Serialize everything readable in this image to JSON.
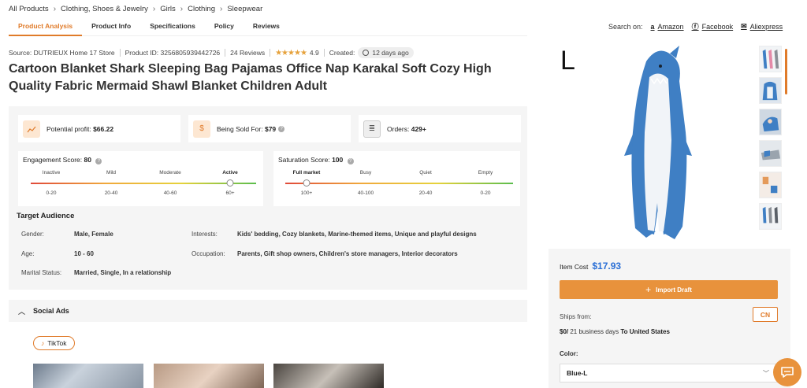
{
  "breadcrumb": [
    "All Products",
    "Clothing, Shoes & Jewelry",
    "Girls",
    "Clothing",
    "Sleepwear"
  ],
  "tabs": [
    "Product Analysis",
    "Product Info",
    "Specifications",
    "Policy",
    "Reviews"
  ],
  "search_on": {
    "label": "Search on:",
    "sites": [
      {
        "name": "Amazon",
        "icon": "amazon-icon"
      },
      {
        "name": "Facebook",
        "icon": "facebook-icon"
      },
      {
        "name": "Aliexpress",
        "icon": "aliexpress-icon"
      }
    ]
  },
  "meta": {
    "source": "Source: DUTRIEUX Home 17 Store",
    "product_id": "Product ID: 3256805939442726",
    "reviews": "24 Reviews",
    "rating": "4.9",
    "rating_stars": 4.5,
    "created_label": "Created:",
    "created_value": "12 days ago"
  },
  "title": "Cartoon Blanket Shark Sleeping Bag Pajamas Office Nap Karakal Soft Cozy High Quality Fabric Mermaid Shawl Blanket Children Adult",
  "stats": {
    "profit_label": "Potential profit:",
    "profit_value": "$66.22",
    "sold_label": "Being Sold For:",
    "sold_value": "$79",
    "orders_label": "Orders:",
    "orders_value": "429+"
  },
  "engagement": {
    "label": "Engagement Score:",
    "value": "80",
    "levels": [
      "Inactive",
      "Mild",
      "Moderate",
      "Active"
    ],
    "ranges": [
      "0-20",
      "20-40",
      "40-60",
      "60+"
    ],
    "active_index": 3
  },
  "saturation": {
    "label": "Saturation Score:",
    "value": "100",
    "levels": [
      "Full market",
      "Busy",
      "Quiet",
      "Empty"
    ],
    "ranges": [
      "100+",
      "40-100",
      "20-40",
      "0-20"
    ],
    "active_index": 0
  },
  "target_audience": {
    "title": "Target Audience",
    "gender_label": "Gender:",
    "gender": "Male, Female",
    "age_label": "Age:",
    "age": "10 - 60",
    "marital_label": "Marital Status:",
    "marital": "Married, Single, In a relationship",
    "interests_label": "Interests:",
    "interests": "Kids' bedding, Cozy blankets, Marine-themed items, Unique and playful designs",
    "occupation_label": "Occupation:",
    "occupation": "Parents, Gift shop owners, Children's store managers, Interior decorators"
  },
  "social_ads": {
    "title": "Social Ads",
    "platform": "TikTok"
  },
  "gallery": {
    "size_label": "L"
  },
  "buy": {
    "item_cost_label": "Item Cost",
    "item_cost": "$17.93",
    "import_label": "Import Draft",
    "ships_from_label": "Ships from:",
    "ships_from": "CN",
    "shipping_cost": "$0/",
    "shipping_days": " 21 business days ",
    "shipping_dest": "To United States",
    "color_label": "Color:",
    "color_value": "Blue-L"
  },
  "colors": {
    "accent": "#e07b2a",
    "price": "#2a6fd6",
    "panel": "#f5f5f5"
  }
}
